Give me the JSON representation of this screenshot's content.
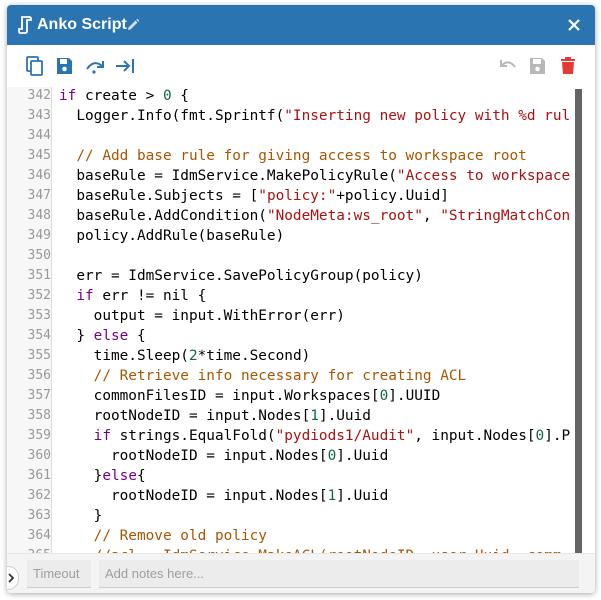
{
  "dialog": {
    "title": "Anko Script",
    "icons": {
      "title": "script-icon",
      "edit": "pencil-icon",
      "close": "close-icon"
    }
  },
  "toolbar": {
    "left": [
      "copy-icon",
      "save-to-file-icon",
      "redo-step-icon",
      "indent-arrow-icon"
    ],
    "right": [
      "undo-icon",
      "save-icon",
      "delete-icon"
    ],
    "colors": {
      "left": "#2a74b1",
      "disabled": "#b8b8b8",
      "delete": "#e53935"
    }
  },
  "editor": {
    "lines": [
      {
        "n": "342",
        "tokens": [
          [
            "keyword",
            "if"
          ],
          [
            "plain",
            " create > "
          ],
          [
            "number",
            "0"
          ],
          [
            "plain",
            " {"
          ]
        ]
      },
      {
        "n": "343",
        "tokens": [
          [
            "plain",
            "  Logger.Info(fmt.Sprintf("
          ],
          [
            "string",
            "\"Inserting new policy with %d rul"
          ]
        ]
      },
      {
        "n": "344",
        "tokens": []
      },
      {
        "n": "345",
        "tokens": [
          [
            "comment",
            "  // Add base rule for giving access to workspace root"
          ]
        ]
      },
      {
        "n": "346",
        "tokens": [
          [
            "plain",
            "  baseRule = IdmService.MakePolicyRule("
          ],
          [
            "string",
            "\"Access to workspace"
          ]
        ]
      },
      {
        "n": "347",
        "tokens": [
          [
            "plain",
            "  baseRule.Subjects = ["
          ],
          [
            "string",
            "\"policy:\""
          ],
          [
            "plain",
            "+policy.Uuid]"
          ]
        ]
      },
      {
        "n": "348",
        "tokens": [
          [
            "plain",
            "  baseRule.AddCondition("
          ],
          [
            "string",
            "\"NodeMeta:ws_root\""
          ],
          [
            "plain",
            ", "
          ],
          [
            "string",
            "\"StringMatchCon"
          ]
        ]
      },
      {
        "n": "349",
        "tokens": [
          [
            "plain",
            "  policy.AddRule(baseRule)"
          ]
        ]
      },
      {
        "n": "350",
        "tokens": []
      },
      {
        "n": "351",
        "tokens": [
          [
            "plain",
            "  err = IdmService.SavePolicyGroup(policy)"
          ]
        ]
      },
      {
        "n": "352",
        "tokens": [
          [
            "plain",
            "  "
          ],
          [
            "keyword",
            "if"
          ],
          [
            "plain",
            " err != nil {"
          ]
        ]
      },
      {
        "n": "353",
        "tokens": [
          [
            "plain",
            "    output = input.WithError(err)"
          ]
        ]
      },
      {
        "n": "354",
        "tokens": [
          [
            "plain",
            "  } "
          ],
          [
            "keyword",
            "else"
          ],
          [
            "plain",
            " {"
          ]
        ]
      },
      {
        "n": "355",
        "tokens": [
          [
            "plain",
            "    time.Sleep("
          ],
          [
            "number",
            "2"
          ],
          [
            "plain",
            "*time.Second)"
          ]
        ]
      },
      {
        "n": "356",
        "tokens": [
          [
            "comment",
            "    // Retrieve info necessary for creating ACL"
          ]
        ]
      },
      {
        "n": "357",
        "tokens": [
          [
            "plain",
            "    commonFilesID = input.Workspaces["
          ],
          [
            "number",
            "0"
          ],
          [
            "plain",
            "].UUID"
          ]
        ]
      },
      {
        "n": "358",
        "tokens": [
          [
            "plain",
            "    rootNodeID = input.Nodes["
          ],
          [
            "number",
            "1"
          ],
          [
            "plain",
            "].Uuid"
          ]
        ]
      },
      {
        "n": "359",
        "tokens": [
          [
            "plain",
            "    "
          ],
          [
            "keyword",
            "if"
          ],
          [
            "plain",
            " strings.EqualFold("
          ],
          [
            "string",
            "\"pydiods1/Audit\""
          ],
          [
            "plain",
            ", input.Nodes["
          ],
          [
            "number",
            "0"
          ],
          [
            "plain",
            "].P"
          ]
        ]
      },
      {
        "n": "360",
        "tokens": [
          [
            "plain",
            "      rootNodeID = input.Nodes["
          ],
          [
            "number",
            "0"
          ],
          [
            "plain",
            "].Uuid"
          ]
        ]
      },
      {
        "n": "361",
        "tokens": [
          [
            "plain",
            "    }"
          ],
          [
            "keyword",
            "else"
          ],
          [
            "plain",
            "{"
          ]
        ]
      },
      {
        "n": "362",
        "tokens": [
          [
            "plain",
            "      rootNodeID = input.Nodes["
          ],
          [
            "number",
            "1"
          ],
          [
            "plain",
            "].Uuid"
          ]
        ]
      },
      {
        "n": "363",
        "tokens": [
          [
            "plain",
            "    }"
          ]
        ]
      },
      {
        "n": "364",
        "tokens": [
          [
            "comment",
            "    // Remove old policy"
          ]
        ]
      },
      {
        "n": "365",
        "tokens": [
          [
            "comment",
            "    //acl = IdmService.MakeACL(rootNodeID, user.Uuid, comm"
          ]
        ]
      }
    ],
    "colors": {
      "keyword": "#770088",
      "string": "#aa1111",
      "number": "#116644",
      "comment": "#aa5500"
    }
  },
  "footer": {
    "expand_icon": "chevron-right-icon",
    "timeout_placeholder": "Timeout",
    "notes_placeholder": "Add notes here..."
  }
}
